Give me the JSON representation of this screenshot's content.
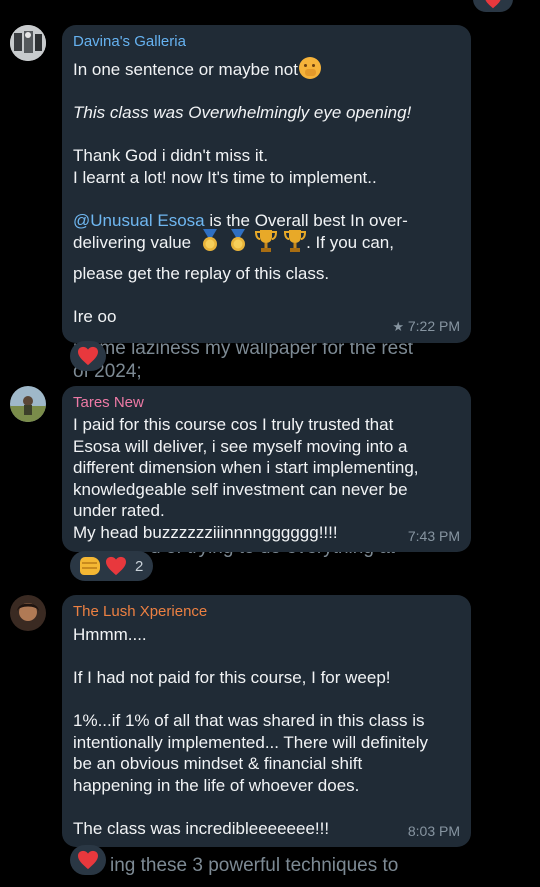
{
  "messages": [
    {
      "sender": "Davina's Galleria",
      "sender_color": "#66b2f0",
      "intro": "In one sentence or maybe not",
      "italic": "This class was Overwhelmingly eye opening!",
      "line1": "Thank God i didn't miss it.",
      "line2": "I learnt a lot!  now It's time to implement..",
      "mention": "@Unusual Esosa",
      "mention_rest": " is the Overall best In over-",
      "line4": "delivering value",
      "line4_rest": ". If you can,",
      "line5": "please get the replay of this class.",
      "line6": "Ire oo",
      "time": "7:22 PM",
      "behind_text": "rcome laziness my wallpaper for the rest",
      "behind_text2": "of 2024;"
    },
    {
      "sender": "Tares New",
      "sender_color": "#ee7aa6",
      "lines": [
        "I paid for this course cos I truly trusted that",
        "Esosa will deliver, i see myself moving into a",
        "different dimension when i start implementing,",
        "knowledgeable self investment can never be",
        "under rated.",
        "My head buzzzzzziiinnnngggggg!!!!"
      ],
      "time": "7:43 PM",
      "reaction_count": "2",
      "behind_text": "d of trying to do everything at"
    },
    {
      "sender": "The Lush Xperience",
      "sender_color": "#ec8042",
      "line1": "Hmmm....",
      "line2": "If I had not paid for this course, I for weep!",
      "para": [
        "1%...if 1% of all that was shared in this class is",
        "intentionally implemented... There will definitely",
        "be an obvious mindset & financial shift",
        "happening in the life of whoever does."
      ],
      "line_last": "The class was incredibleeeeeee!!!",
      "time": "8:03 PM",
      "behind_text": "ing these 3 powerful techniques to"
    }
  ]
}
